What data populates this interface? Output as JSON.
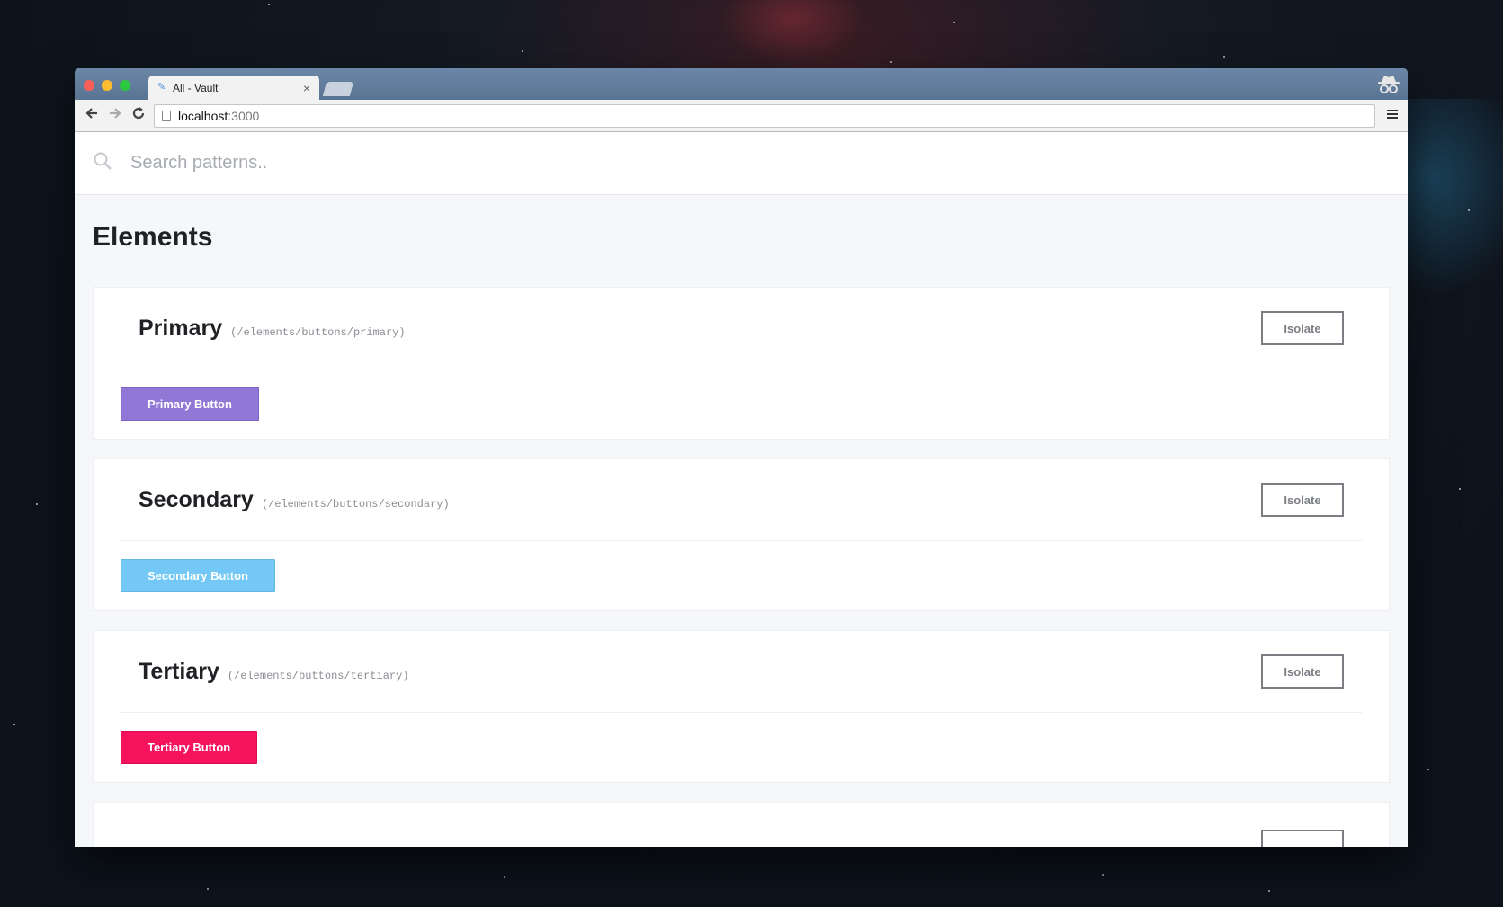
{
  "browser": {
    "tab_title": "All - Vault",
    "tab_close": "×",
    "url_host": "localhost",
    "url_port": ":3000"
  },
  "icons": {
    "back": "back-arrow-icon",
    "forward": "forward-arrow-icon",
    "reload": "reload-icon",
    "menu": "hamburger-menu-icon",
    "search": "search-icon",
    "incognito": "incognito-icon"
  },
  "search": {
    "placeholder": "Search patterns.."
  },
  "page": {
    "title": "Elements"
  },
  "patterns": [
    {
      "name": "Primary",
      "path": "(/elements/buttons/primary)",
      "isolate_label": "Isolate",
      "demo_label": "Primary Button",
      "color": "#9178d6"
    },
    {
      "name": "Secondary",
      "path": "(/elements/buttons/secondary)",
      "isolate_label": "Isolate",
      "demo_label": "Secondary Button",
      "color": "#74c8f6"
    },
    {
      "name": "Tertiary",
      "path": "(/elements/buttons/tertiary)",
      "isolate_label": "Isolate",
      "demo_label": "Tertiary Button",
      "color": "#f6135e"
    }
  ]
}
